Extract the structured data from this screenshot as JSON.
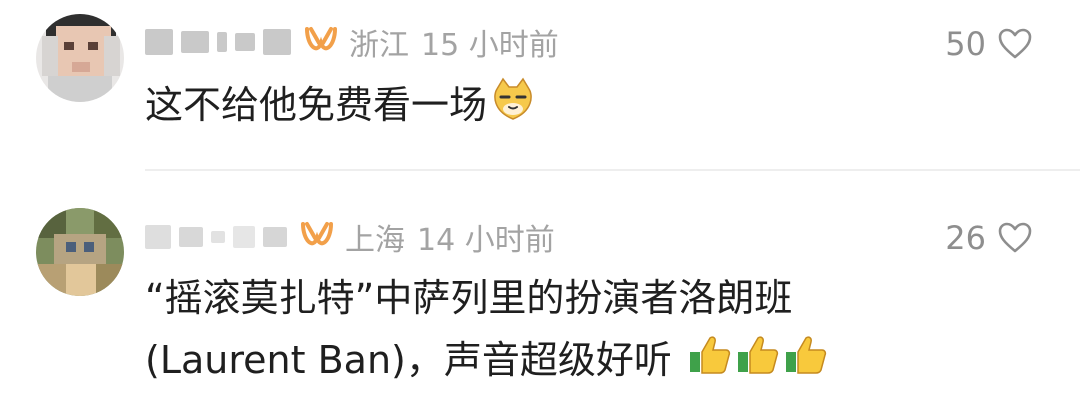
{
  "comments": [
    {
      "location": "浙江",
      "time": "15 小时前",
      "likes": "50",
      "text": "这不给他免费看一场",
      "emoji": "smug-cat-face-emoji",
      "username_visible": false
    },
    {
      "location": "上海",
      "time": "14 小时前",
      "likes": "26",
      "text_line1": "“摇滚莫扎特”中萨列里的扮演者洛朗班",
      "text_line2": "(Laurent Ban)，声音超级好听",
      "emoji": "thumbs-up-emoji",
      "emoji_count": 3,
      "username_visible": false
    }
  ],
  "colors": {
    "text": "#1f1f1f",
    "meta": "#a3a3a3",
    "badge": "#f2a04a",
    "heart": "#8e8e8e",
    "divider": "#eeeeee"
  }
}
